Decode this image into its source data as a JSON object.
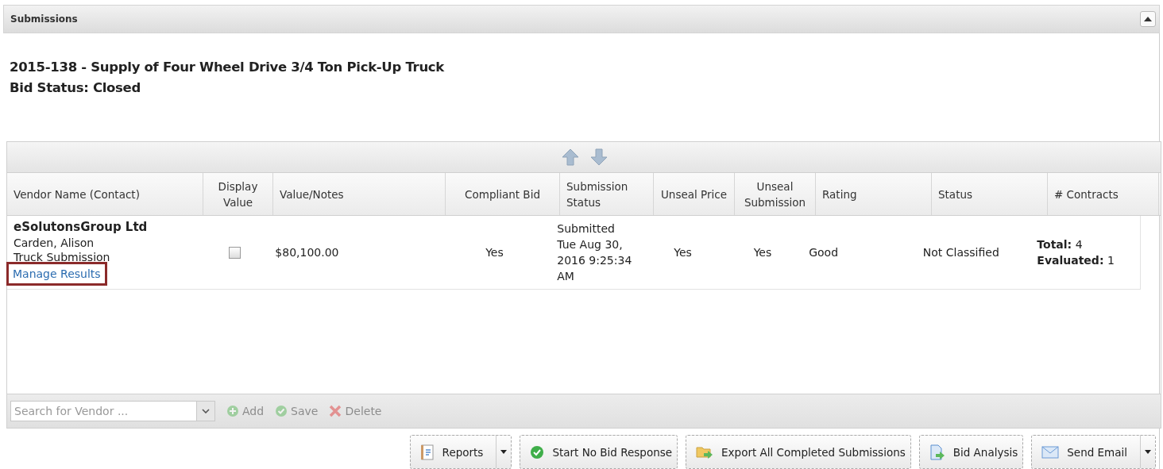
{
  "panel": {
    "title": "Submissions",
    "collapsed": false
  },
  "bid": {
    "title": "2015-138 - Supply of Four Wheel Drive 3/4 Ton Pick-Up Truck",
    "status": "Bid Status: Closed"
  },
  "table": {
    "columns": [
      {
        "label": "Vendor Name (Contact)"
      },
      {
        "label": "Display Value"
      },
      {
        "label": "Value/Notes"
      },
      {
        "label": "Compliant Bid"
      },
      {
        "label": "Submission Status"
      },
      {
        "label": "Unseal Price"
      },
      {
        "label": "Unseal Submission"
      },
      {
        "label": "Rating"
      },
      {
        "label": "Status"
      },
      {
        "label": "# Contracts"
      }
    ],
    "rows": [
      {
        "vendor": "eSolutonsGroup Ltd",
        "contact": "Carden, Alison",
        "note": "Truck Submission",
        "link": "Manage Results",
        "display_value": {
          "checked": false
        },
        "value": "$80,100.00",
        "compliant": "Yes",
        "submission_status": "Submitted Tue Aug 30, 2016 9:25:34 AM",
        "unseal_price": "Yes",
        "unseal_submission": "Yes",
        "rating": "Good",
        "status": "Not Classified",
        "contracts": [
          "**Total:** 4",
          "**Evaluated:** 1"
        ]
      }
    ]
  },
  "toolbar": {
    "search": {
      "placeholder": "Search for Vendor ..."
    },
    "actions": [
      {
        "label": "Add",
        "kind": "add",
        "disabled": true
      },
      {
        "label": "Save",
        "kind": "save",
        "disabled": true
      },
      {
        "label": "Delete",
        "kind": "delete",
        "disabled": true
      }
    ]
  },
  "buttons": [
    {
      "label": "Reports",
      "dropdown": true
    },
    {
      "label": "Start No Bid Response",
      "dropdown": false
    },
    {
      "label": "Export All Completed Submissions",
      "dropdown": false
    },
    {
      "label": "Bid Analysis",
      "dropdown": false
    },
    {
      "label": "Send Email",
      "dropdown": true
    }
  ]
}
